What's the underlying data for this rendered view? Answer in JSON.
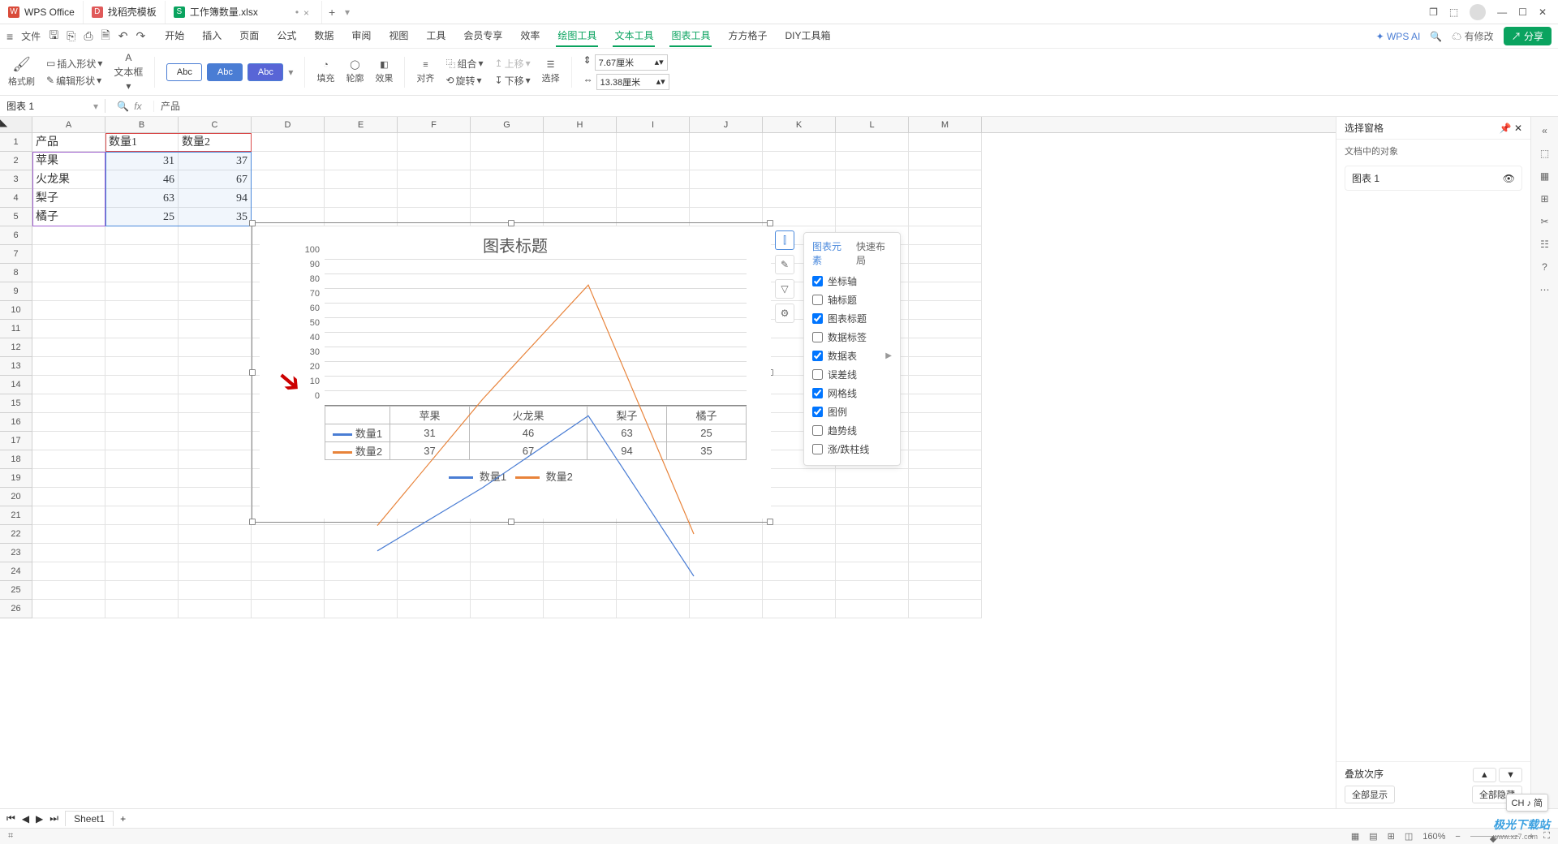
{
  "titlebar": {
    "tabs": [
      {
        "icon": "W",
        "iconbg": "#d94b3a",
        "label": "WPS Office"
      },
      {
        "icon": "D",
        "iconbg": "#e05a5a",
        "label": "找稻壳模板"
      },
      {
        "icon": "S",
        "iconbg": "#0aa35f",
        "label": "工作簿数量.xlsx",
        "dirty": "•"
      }
    ],
    "add": "+"
  },
  "menubar": {
    "file": "文件",
    "tabs": [
      "开始",
      "插入",
      "页面",
      "公式",
      "数据",
      "审阅",
      "视图",
      "工具",
      "会员专享",
      "效率",
      "绘图工具",
      "文本工具",
      "图表工具",
      "方方格子",
      "DIY工具箱"
    ],
    "ctx_start": 10,
    "ctx_end": 12,
    "wpsai": "WPS AI",
    "modify": "有修改",
    "share": "分享"
  },
  "ribbon": {
    "brush": "格式刷",
    "insertshape": "插入形状",
    "textbox": "文本框",
    "editshape": "编辑形状",
    "abc": "Abc",
    "fill": "填充",
    "outline": "轮廓",
    "effect": "效果",
    "align": "对齐",
    "group": "组合",
    "rotate": "旋转",
    "up": "上移",
    "down": "下移",
    "select": "选择",
    "w": "7.67厘米",
    "h": "13.38厘米"
  },
  "fbar": {
    "name": "图表 1",
    "formula": "产品"
  },
  "columns": [
    "A",
    "B",
    "C",
    "D",
    "E",
    "F",
    "G",
    "H",
    "I",
    "J",
    "K",
    "L",
    "M"
  ],
  "rows": 26,
  "table": {
    "header": [
      "产品",
      "数量1",
      "数量2"
    ],
    "data": [
      [
        "苹果",
        31,
        37
      ],
      [
        "火龙果",
        46,
        67
      ],
      [
        "梨子",
        63,
        94
      ],
      [
        "橘子",
        25,
        35
      ]
    ]
  },
  "chart_data": {
    "type": "line",
    "title": "图表标题",
    "categories": [
      "苹果",
      "火龙果",
      "梨子",
      "橘子"
    ],
    "series": [
      {
        "name": "数量1",
        "values": [
          31,
          46,
          63,
          25
        ],
        "color": "#4a7dd4"
      },
      {
        "name": "数量2",
        "values": [
          37,
          67,
          94,
          35
        ],
        "color": "#e8833a"
      }
    ],
    "ylim": [
      0,
      100
    ],
    "ytick": 10
  },
  "chart_popup": {
    "tabs": [
      "图表元素",
      "快速布局"
    ],
    "items": [
      {
        "label": "坐标轴",
        "checked": true
      },
      {
        "label": "轴标题",
        "checked": false
      },
      {
        "label": "图表标题",
        "checked": true
      },
      {
        "label": "数据标签",
        "checked": false
      },
      {
        "label": "数据表",
        "checked": true,
        "arrow": true
      },
      {
        "label": "误差线",
        "checked": false
      },
      {
        "label": "网格线",
        "checked": true
      },
      {
        "label": "图例",
        "checked": true
      },
      {
        "label": "趋势线",
        "checked": false
      },
      {
        "label": "涨/跌柱线",
        "checked": false
      }
    ]
  },
  "rpanel": {
    "title": "选择窗格",
    "sub": "文档中的对象",
    "obj": "图表 1",
    "stack": "叠放次序",
    "showall": "全部显示",
    "hideall": "全部隐藏"
  },
  "sheettab": "Sheet1",
  "status": {
    "zoom": "160%",
    "ime": "CH ♪ 简"
  },
  "watermark": {
    "a": "极光下载站",
    "b": "www.xz7.com"
  }
}
